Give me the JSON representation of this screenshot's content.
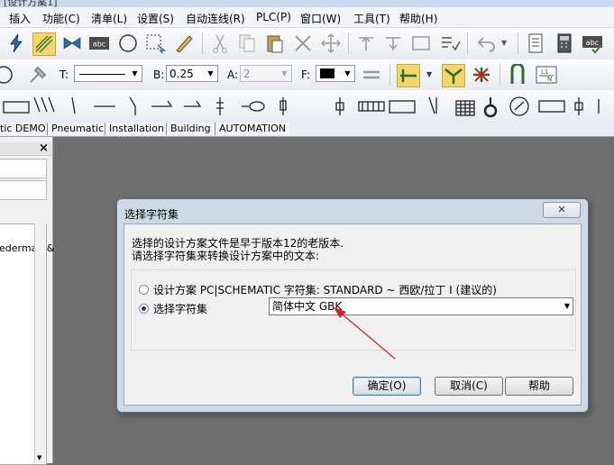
{
  "window": {
    "title": "[设计方案1]"
  },
  "menu": [
    "插入",
    "功能(C)",
    "清单(L)",
    "设置(S)",
    "自动连线(R)",
    "PLC(P)",
    "窗口(W)",
    "工具(T)",
    "帮助(H)"
  ],
  "toolbar2": {
    "t_label": "T:",
    "b_label": "B:",
    "b_value": "0.25",
    "a_label": "A:",
    "a_value": "2",
    "f_label": "F:",
    "fill_color": "#000000"
  },
  "tabs": [
    "tic DEMO",
    "Pneumatic",
    "Installation",
    "Building",
    "AUTOMATION"
  ],
  "leftpanel": {
    "close": "×",
    "list_item": "ederman &"
  },
  "dialog": {
    "title": "选择字符集",
    "close": "✕",
    "message_line1": "选择的设计方案文件是早于版本12的老版本.",
    "message_line2": "请选择字符集来转换设计方案中的文本:",
    "option1": "设计方案 PC|SCHEMATIC 字符集: STANDARD ~ 西欧/拉丁 I (建议的)",
    "option2": "选择字符集",
    "charset_value": "简体中文 GBK",
    "ok": "确定(O)",
    "cancel": "取消(C)",
    "help": "帮助"
  },
  "colors": {
    "accent_arrow": "#d42020",
    "selected_icon_bg": "#f1d66b"
  }
}
